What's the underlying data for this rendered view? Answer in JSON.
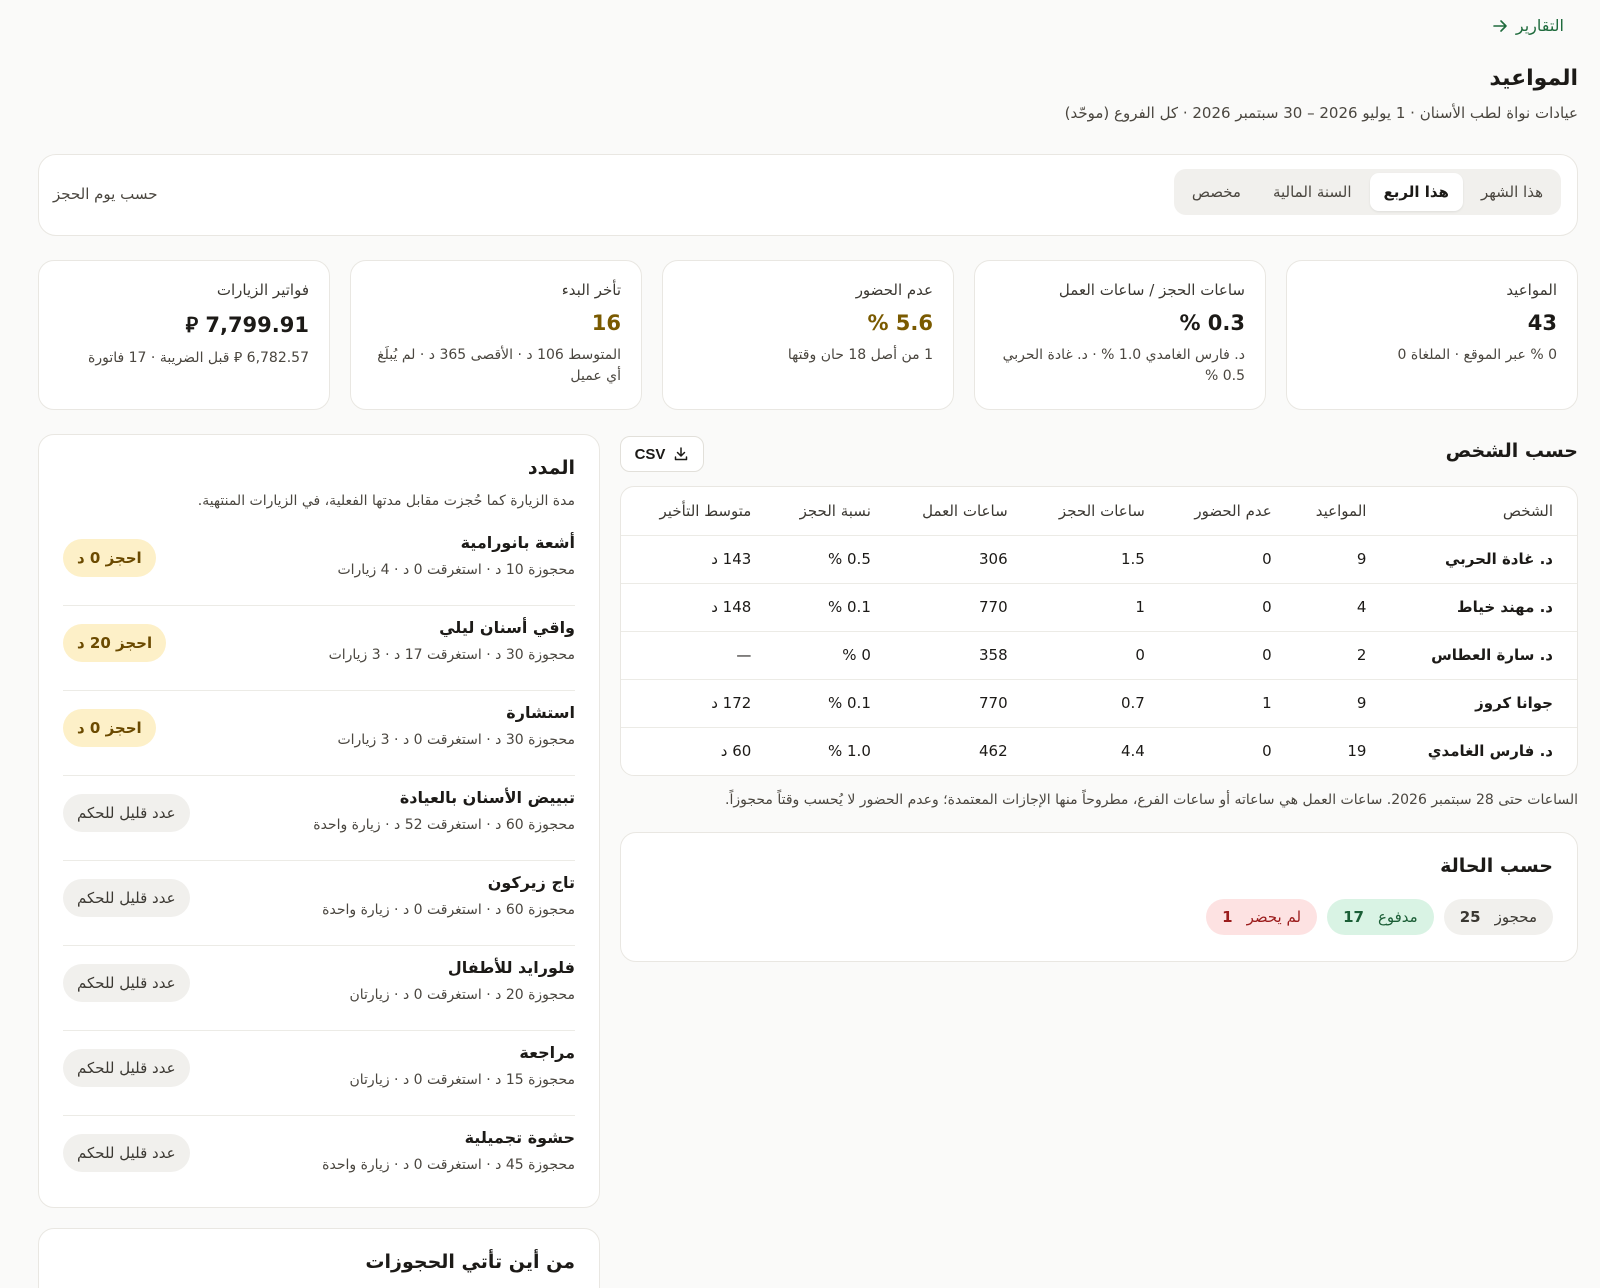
{
  "nav": {
    "back_label": "التقارير"
  },
  "page": {
    "title": "المواعيد",
    "subtitle": "عيادات نواة لطب الأسنان · 1 يوليو 2026 – 30 سبتمبر 2026 · كل الفروع (موحّد)"
  },
  "filters": {
    "periods": [
      "هذا الشهر",
      "هذا الربع",
      "السنة المالية",
      "مخصص"
    ],
    "active_period": "هذا الربع",
    "mode": "حسب يوم الحجز"
  },
  "kpis": [
    {
      "label": "المواعيد",
      "value": "43",
      "note": "0 % عبر الموقع · الملغاة 0"
    },
    {
      "label": "ساعات الحجز / ساعات العمل",
      "value": "0.3 %",
      "note": "د. فارس الغامدي 1.0 % · د. غادة الحربي 0.5 %"
    },
    {
      "label": "عدم الحضور",
      "value": "5.6 %",
      "note": "1 من أصل 18 حان وقتها"
    },
    {
      "label": "تأخر البدء",
      "value": "16",
      "note": "المتوسط 106 د · الأقصى 365 د · لم يُبلَغ أي عميل"
    },
    {
      "label": "فواتير الزيارات",
      "value": "7,799.91 ⃁",
      "note": "6,782.57 ⃁ قبل الضريبة · 17 فاتورة"
    }
  ],
  "by_person": {
    "title": "حسب الشخص",
    "csv_label": "CSV",
    "columns": [
      "الشخص",
      "المواعيد",
      "عدم الحضور",
      "ساعات الحجز",
      "ساعات العمل",
      "نسبة الحجز",
      "متوسط التأخير"
    ],
    "rows": [
      [
        "د. غادة الحربي",
        "9",
        "0",
        "1.5",
        "306",
        "0.5 %",
        "143 د"
      ],
      [
        "د. مهند خياط",
        "4",
        "0",
        "1",
        "770",
        "0.1 %",
        "148 د"
      ],
      [
        "د. سارة العطاس",
        "2",
        "0",
        "0",
        "358",
        "0 %",
        "—"
      ],
      [
        "جوانا كروز",
        "9",
        "1",
        "0.7",
        "770",
        "0.1 %",
        "172 د"
      ],
      [
        "د. فارس الغامدي",
        "19",
        "0",
        "4.4",
        "462",
        "1.0 %",
        "60 د"
      ]
    ],
    "note": "الساعات حتى 28 سبتمبر 2026. ساعات العمل هي ساعاته أو ساعات الفرع، مطروحاً منها الإجازات المعتمدة؛ وعدم الحضور لا يُحسب وقتاً محجوزاً."
  },
  "by_status": {
    "title": "حسب الحالة",
    "items": [
      {
        "label": "محجوز",
        "count": "25",
        "kind": "booked"
      },
      {
        "label": "مدفوع",
        "count": "17",
        "kind": "paid"
      },
      {
        "label": "لم يحضر",
        "count": "1",
        "kind": "noshow"
      }
    ]
  },
  "durations": {
    "title": "المدد",
    "description": "مدة الزيارة كما حُجزت مقابل مدتها الفعلية، في الزيارات المنتهية.",
    "items": [
      {
        "name": "أشعة بانورامية",
        "meta": "محجوزة 10 د · استغرقت 0 د · 4 زيارات",
        "badge": "احجز 0 د",
        "kind": "warn"
      },
      {
        "name": "واقي أسنان ليلي",
        "meta": "محجوزة 30 د · استغرقت 17 د · 3 زيارات",
        "badge": "احجز 20 د",
        "kind": "warn"
      },
      {
        "name": "استشارة",
        "meta": "محجوزة 30 د · استغرقت 0 د · 3 زيارات",
        "badge": "احجز 0 د",
        "kind": "warn"
      },
      {
        "name": "تبييض الأسنان بالعيادة",
        "meta": "محجوزة 60 د · استغرقت 52 د · زيارة واحدة",
        "badge": "عدد قليل للحكم",
        "kind": "neutral"
      },
      {
        "name": "تاج زيركون",
        "meta": "محجوزة 60 د · استغرقت 0 د · زيارة واحدة",
        "badge": "عدد قليل للحكم",
        "kind": "neutral"
      },
      {
        "name": "فلورايد للأطفال",
        "meta": "محجوزة 20 د · استغرقت 0 د · زيارتان",
        "badge": "عدد قليل للحكم",
        "kind": "neutral"
      },
      {
        "name": "مراجعة",
        "meta": "محجوزة 15 د · استغرقت 0 د · زيارتان",
        "badge": "عدد قليل للحكم",
        "kind": "neutral"
      },
      {
        "name": "حشوة تجميلية",
        "meta": "محجوزة 45 د · استغرقت 0 د · زيارة واحدة",
        "badge": "عدد قليل للحكم",
        "kind": "neutral"
      }
    ]
  },
  "sources": {
    "title": "من أين تأتي الحجوزات"
  },
  "icons": {
    "back": "arrow-right-icon",
    "csv": "download-icon"
  },
  "colors": {
    "link": "#1f6b3d",
    "amber_value": "#7a5a00",
    "paid_bg": "#d9f3e4",
    "noshow_bg": "#fde2e2",
    "warn_badge_bg": "#fdf0c8"
  }
}
